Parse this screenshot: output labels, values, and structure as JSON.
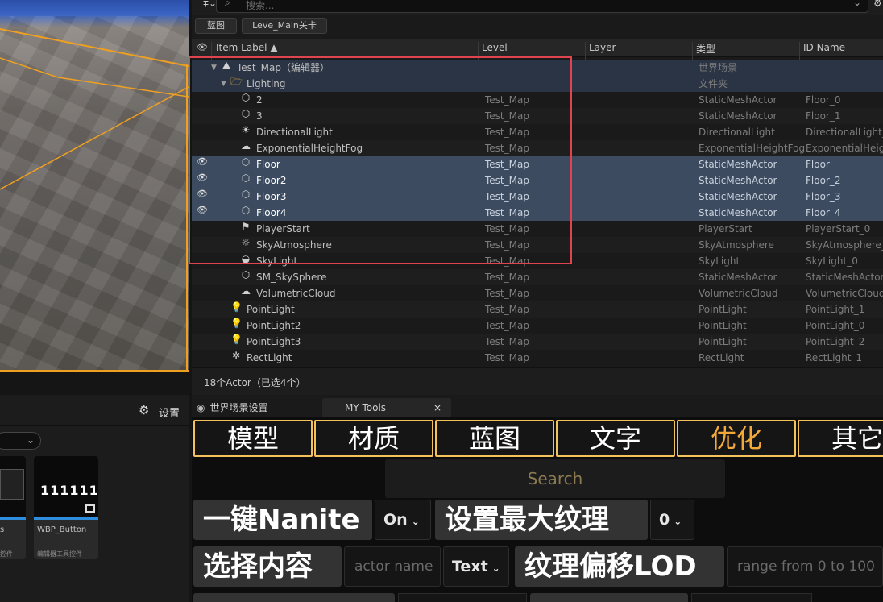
{
  "search": {
    "placeholder": "搜索..."
  },
  "filter_chips": [
    "蓝图",
    "Leve_Main关卡"
  ],
  "columns": {
    "item_label": "Item Label ▲",
    "level": "Level",
    "layer": "Layer",
    "type": "类型",
    "id_name": "ID Name"
  },
  "rows": [
    {
      "label": "Test_Map（编辑器）",
      "level": "",
      "type": "世界场景",
      "id": "",
      "icon": "map-icon",
      "glyph": "⛰",
      "indent": 1,
      "arrow": "▼",
      "visible": false
    },
    {
      "label": "Lighting",
      "level": "",
      "type": "文件夹",
      "id": "",
      "icon": "folder-icon",
      "glyph": "🗁",
      "indent": 2,
      "arrow": "▼",
      "visible": false
    },
    {
      "label": "2",
      "level": "Test_Map",
      "type": "StaticMeshActor",
      "id": "Floor_0",
      "icon": "static-mesh-icon",
      "glyph": "⬡",
      "indent": 3,
      "arrow": "",
      "visible": false
    },
    {
      "label": "3",
      "level": "Test_Map",
      "type": "StaticMeshActor",
      "id": "Floor_1",
      "icon": "static-mesh-icon",
      "glyph": "⬡",
      "indent": 3,
      "arrow": "",
      "visible": false
    },
    {
      "label": "DirectionalLight",
      "level": "Test_Map",
      "type": "DirectionalLight",
      "id": "DirectionalLight_",
      "icon": "directional-light-icon",
      "glyph": "☀",
      "indent": 3,
      "arrow": "",
      "visible": false
    },
    {
      "label": "ExponentialHeightFog",
      "level": "Test_Map",
      "type": "ExponentialHeightFog",
      "id": "ExponentialHeigh",
      "icon": "fog-icon",
      "glyph": "☁",
      "indent": 3,
      "arrow": "",
      "visible": false
    },
    {
      "label": "Floor",
      "level": "Test_Map",
      "type": "StaticMeshActor",
      "id": "Floor",
      "icon": "static-mesh-icon",
      "glyph": "⬡",
      "indent": 3,
      "arrow": "",
      "visible": true
    },
    {
      "label": "Floor2",
      "level": "Test_Map",
      "type": "StaticMeshActor",
      "id": "Floor_2",
      "icon": "static-mesh-icon",
      "glyph": "⬡",
      "indent": 3,
      "arrow": "",
      "visible": true
    },
    {
      "label": "Floor3",
      "level": "Test_Map",
      "type": "StaticMeshActor",
      "id": "Floor_3",
      "icon": "static-mesh-icon",
      "glyph": "⬡",
      "indent": 3,
      "arrow": "",
      "visible": true
    },
    {
      "label": "Floor4",
      "level": "Test_Map",
      "type": "StaticMeshActor",
      "id": "Floor_4",
      "icon": "static-mesh-icon",
      "glyph": "⬡",
      "indent": 3,
      "arrow": "",
      "visible": true
    },
    {
      "label": "PlayerStart",
      "level": "Test_Map",
      "type": "PlayerStart",
      "id": "PlayerStart_0",
      "icon": "player-start-icon",
      "glyph": "⚑",
      "indent": 3,
      "arrow": "",
      "visible": false
    },
    {
      "label": "SkyAtmosphere",
      "level": "Test_Map",
      "type": "SkyAtmosphere",
      "id": "SkyAtmosphere_",
      "icon": "sky-atmosphere-icon",
      "glyph": "☼",
      "indent": 3,
      "arrow": "",
      "visible": false
    },
    {
      "label": "SkyLight",
      "level": "Test_Map",
      "type": "SkyLight",
      "id": "SkyLight_0",
      "icon": "sky-light-icon",
      "glyph": "◒",
      "indent": 3,
      "arrow": "",
      "visible": false
    },
    {
      "label": "SM_SkySphere",
      "level": "Test_Map",
      "type": "StaticMeshActor",
      "id": "StaticMeshActor",
      "icon": "static-mesh-icon",
      "glyph": "⬡",
      "indent": 3,
      "arrow": "",
      "visible": false
    },
    {
      "label": "VolumetricCloud",
      "level": "Test_Map",
      "type": "VolumetricCloud",
      "id": "VolumetricCloud_",
      "icon": "cloud-icon",
      "glyph": "☁",
      "indent": 3,
      "arrow": "",
      "visible": false
    },
    {
      "label": "PointLight",
      "level": "Test_Map",
      "type": "PointLight",
      "id": "PointLight_1",
      "icon": "point-light-icon",
      "glyph": "💡",
      "indent": 2,
      "arrow": "",
      "visible": false
    },
    {
      "label": "PointLight2",
      "level": "Test_Map",
      "type": "PointLight",
      "id": "PointLight_0",
      "icon": "point-light-icon",
      "glyph": "💡",
      "indent": 2,
      "arrow": "",
      "visible": false
    },
    {
      "label": "PointLight3",
      "level": "Test_Map",
      "type": "PointLight",
      "id": "PointLight_2",
      "icon": "point-light-icon",
      "glyph": "💡",
      "indent": 2,
      "arrow": "",
      "visible": false
    },
    {
      "label": "RectLight",
      "level": "Test_Map",
      "type": "RectLight",
      "id": "RectLight_1",
      "icon": "rect-light-icon",
      "glyph": "✲",
      "indent": 2,
      "arrow": "",
      "visible": false
    }
  ],
  "footer": {
    "count": "18个Actor（已选4个）"
  },
  "left_panel": {
    "settings_label": "设置",
    "cards": [
      {
        "name": "s",
        "sub": "控件"
      },
      {
        "name": "WBP_Button",
        "sub": "编辑器工具控件",
        "thumb_text": "111111"
      }
    ]
  },
  "tools": {
    "tabs": [
      "世界场景设置",
      "MY Tools"
    ],
    "categories": [
      "模型",
      "材质",
      "蓝图",
      "文字",
      "优化",
      "其它"
    ],
    "search_placeholder": "Search",
    "row1": {
      "nanite_button": "一键Nanite",
      "nanite_combo": "On",
      "max_texture_button": "设置最大纹理",
      "max_texture_combo": "0"
    },
    "row2": {
      "select_button": "选择内容",
      "actor_placeholder": "actor name",
      "text_combo": "Text",
      "lod_button": "纹理偏移LOD",
      "range_placeholder": "range from 0 to 100"
    }
  },
  "colors": {
    "selection": "#3c4b60",
    "highlight_box": "#e0454f",
    "category_border": "#f3c25c",
    "active_category_text": "#f3a93a",
    "viewport_outline": "#f0a020"
  }
}
